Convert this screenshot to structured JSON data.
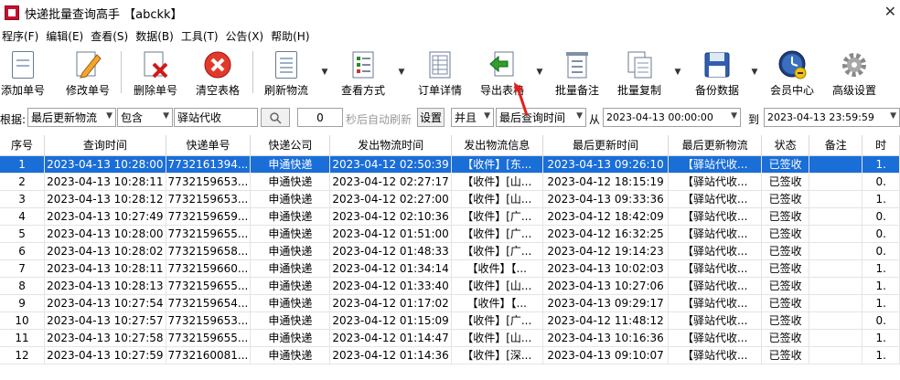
{
  "window": {
    "title": "快递批量查询高手 【abckk】"
  },
  "menu": [
    "程序(F)",
    "编辑(E)",
    "查看(S)",
    "数据(B)",
    "工具(T)",
    "公告(X)",
    "帮助(H)"
  ],
  "toolbar": {
    "add": "添加单号",
    "edit": "修改单号",
    "delete": "删除单号",
    "clear": "清空表格",
    "refresh": "刷新物流",
    "view_mode": "查看方式",
    "detail": "订单详情",
    "export": "导出表格",
    "batch_note": "批量备注",
    "batch_copy": "批量复制",
    "backup": "备份数据",
    "member": "会员中心",
    "settings": "高级设置"
  },
  "filter": {
    "by_label": "根据:",
    "field": "最后更新物流",
    "match": "包含",
    "keyword": "驿站代收",
    "seconds": "0",
    "auto_refresh_label": "秒后自动刷新",
    "set_button": "设置",
    "logic": "并且",
    "time_field": "最后查询时间",
    "from_label": "从",
    "from": "2023-04-13 00:00:00",
    "to_label": "到",
    "to": "2023-04-13 23:59:59"
  },
  "table": {
    "columns": [
      "序号",
      "查询时间",
      "快递单号",
      "快递公司",
      "发出物流时间",
      "发出物流信息",
      "最后更新时间",
      "最后更新物流",
      "状态",
      "备注",
      "时"
    ],
    "rows": [
      [
        "1",
        "2023-04-13 10:28:00",
        "7732161394...",
        "申通快递",
        "2023-04-12 02:50:39",
        "【收件】[东...",
        "2023-04-13 09:26:10",
        "【驿站代收...",
        "已签收",
        "",
        "1."
      ],
      [
        "2",
        "2023-04-13 10:28:11",
        "7732159653...",
        "申通快递",
        "2023-04-12 02:27:17",
        "【收件】[山...",
        "2023-04-12 18:15:19",
        "【驿站代收...",
        "已签收",
        "",
        "0."
      ],
      [
        "3",
        "2023-04-13 10:28:12",
        "7732159653...",
        "申通快递",
        "2023-04-12 02:27:00",
        "【收件】[山...",
        "2023-04-13 09:33:36",
        "【驿站代收...",
        "已签收",
        "",
        "1."
      ],
      [
        "4",
        "2023-04-13 10:27:49",
        "7732159659...",
        "申通快递",
        "2023-04-12 02:10:36",
        "【收件】[广...",
        "2023-04-12 18:42:09",
        "【驿站代收...",
        "已签收",
        "",
        "0."
      ],
      [
        "5",
        "2023-04-13 10:28:00",
        "7732159655...",
        "申通快递",
        "2023-04-12 01:51:00",
        "【收件】[广...",
        "2023-04-12 16:32:25",
        "【驿站代收...",
        "已签收",
        "",
        "0."
      ],
      [
        "6",
        "2023-04-13 10:28:02",
        "7732159658...",
        "申通快递",
        "2023-04-12 01:48:33",
        "【收件】[广...",
        "2023-04-12 19:14:23",
        "【驿站代收...",
        "已签收",
        "",
        "0."
      ],
      [
        "7",
        "2023-04-13 10:28:11",
        "7732159660...",
        "申通快递",
        "2023-04-12 01:34:14",
        "【收件】【...",
        "2023-04-13 10:02:03",
        "【驿站代收...",
        "已签收",
        "",
        "1."
      ],
      [
        "8",
        "2023-04-13 10:28:13",
        "7732159655...",
        "申通快递",
        "2023-04-12 01:33:40",
        "【收件】[山...",
        "2023-04-13 10:27:06",
        "【驿站代收...",
        "已签收",
        "",
        "1."
      ],
      [
        "9",
        "2023-04-13 10:27:54",
        "7732159654...",
        "申通快递",
        "2023-04-12 01:17:02",
        "【收件】【...",
        "2023-04-13 09:29:17",
        "【驿站代收...",
        "已签收",
        "",
        "1."
      ],
      [
        "10",
        "2023-04-13 10:27:57",
        "7732159653...",
        "申通快递",
        "2023-04-12 01:15:09",
        "【收件】[广...",
        "2023-04-12 11:48:12",
        "【驿站代收...",
        "已签收",
        "",
        "0."
      ],
      [
        "11",
        "2023-04-13 10:27:58",
        "7732159655...",
        "申通快递",
        "2023-04-12 01:14:47",
        "【收件】[山...",
        "2023-04-13 10:16:36",
        "【驿站代收...",
        "已签收",
        "",
        "1."
      ],
      [
        "12",
        "2023-04-13 10:27:59",
        "7732160081...",
        "申通快递",
        "2023-04-12 01:14:36",
        "【收件】[深...",
        "2023-04-13 09:10:07",
        "【驿站代收...",
        "已签收",
        "",
        "1."
      ]
    ],
    "selected_row": 0
  },
  "colors": {
    "selection": "#1a6ed8",
    "arrow": "#e02020"
  }
}
